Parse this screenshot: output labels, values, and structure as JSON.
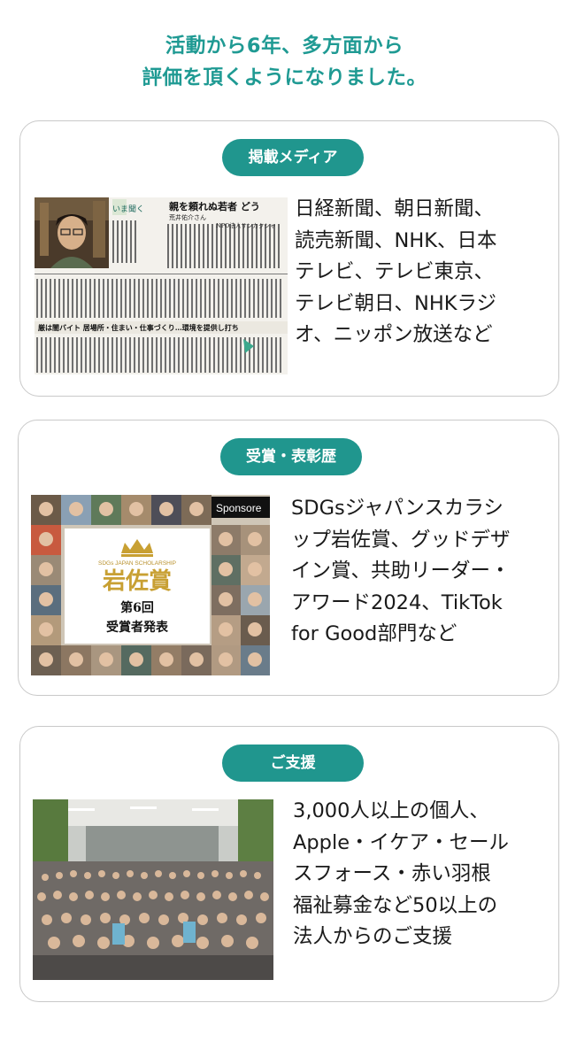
{
  "headline": {
    "line1": "活動から6年、多方面から",
    "line2": "評価を頂くようになりました。"
  },
  "cards": [
    {
      "label": "掲載メディア",
      "text": "日経新聞、朝日新聞、\n読売新聞、NHK、日本\nテレビ、テレビ東京、\nテレビ朝日、NHKラジ\nオ、ニッポン放送など",
      "image": {
        "kicker": "いま聞く",
        "headline_top": "親を頼れぬ若者 どう",
        "byline": "荒井佑介さん",
        "org": "NPO法人サンカクシャ",
        "headline_mid": "厳は闇バイト 居場所・住まい・仕事づくり…環境を提供し打ち"
      }
    },
    {
      "label": "受賞・表彰歴",
      "text": "SDGsジャパンスカラシ\nップ岩佐賞、グッドデザ\nイン賞、共助リーダー・\nアワード2024、TikTok\nfor Good部門など",
      "image": {
        "sponsor_tag": "Sponsore",
        "scholarship": "SDGs JAPAN SCHOLARSHIP",
        "award_name": "岩佐賞",
        "edition": "第6回",
        "announcement": "受賞者発表"
      }
    },
    {
      "label": "ご支援",
      "text": "3,000人以上の個人、\nApple・イケア・セール\nスフォース・赤い羽根\n福祉募金など50以上の\n法人からのご支援"
    }
  ],
  "colors": {
    "accent": "#20968e",
    "headline": "#1f9a93",
    "border": "#c9c9c9",
    "award_gold": "#c8a033"
  }
}
